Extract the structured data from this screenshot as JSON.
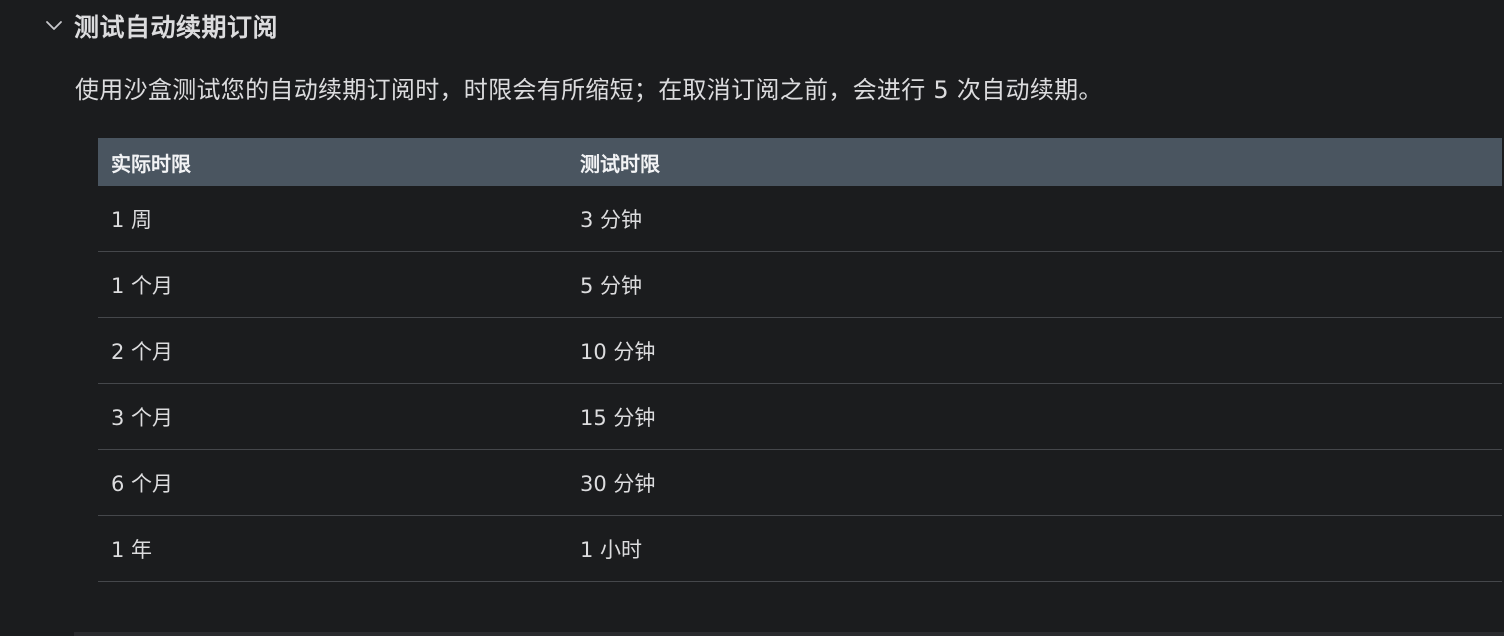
{
  "section": {
    "title": "测试自动续期订阅",
    "expanded_icon": "chevron-down-icon",
    "description": "使用沙盒测试您的自动续期订阅时，时限会有所缩短；在取消订阅之前，会进行 5 次自动续期。"
  },
  "table": {
    "headers": [
      "实际时限",
      "测试时限"
    ],
    "rows": [
      [
        "1 周",
        "3 分钟"
      ],
      [
        "1 个月",
        "5 分钟"
      ],
      [
        "2 个月",
        "10 分钟"
      ],
      [
        "3 个月",
        "15 分钟"
      ],
      [
        "6 个月",
        "30 分钟"
      ],
      [
        "1 年",
        "1 小时"
      ]
    ]
  },
  "colors": {
    "background": "#1b1c1e",
    "header_bg": "#4a5560",
    "divider": "#45474b",
    "text": "#dcdcde"
  }
}
